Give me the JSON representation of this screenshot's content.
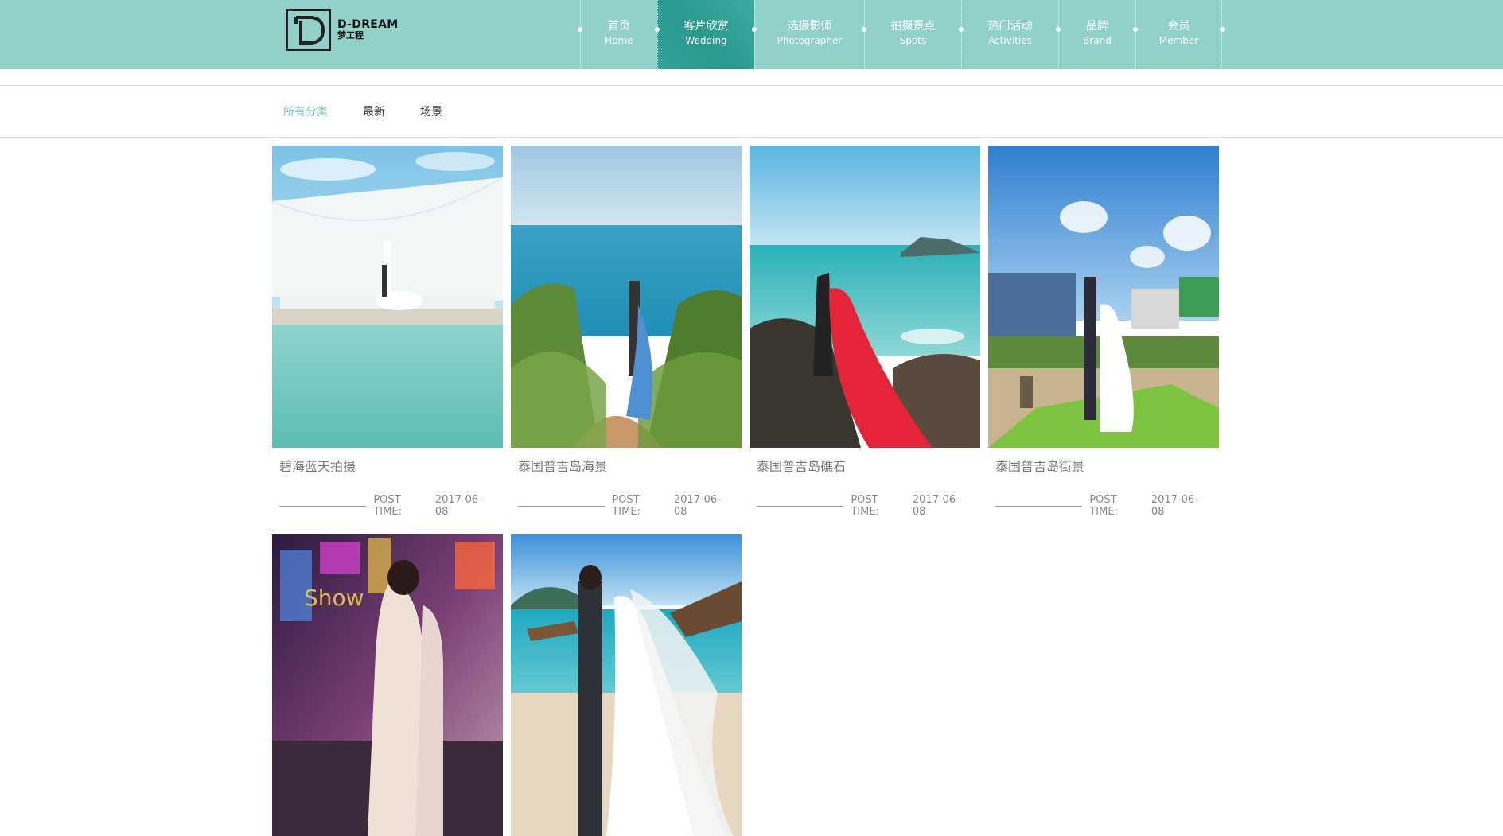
{
  "brand": {
    "title": "D-DREAM",
    "subtitle": "梦工程",
    "icon": "d-letter-logo-icon",
    "color": "#90d1ca",
    "accent": "#2a9a8e"
  },
  "nav": {
    "items": [
      {
        "cn": "首页",
        "en": "Home"
      },
      {
        "cn": "客片欣赏",
        "en": "Wedding"
      },
      {
        "cn": "选摄影师",
        "en": "Photographer"
      },
      {
        "cn": "拍摄景点",
        "en": "Spots"
      },
      {
        "cn": "热门活动",
        "en": "Activities"
      },
      {
        "cn": "品牌",
        "en": "Brand"
      },
      {
        "cn": "会员",
        "en": "Member"
      }
    ],
    "active": "Wedding"
  },
  "filters": {
    "items": [
      "所有分类",
      "最新",
      "场景"
    ],
    "active": "所有分类",
    "active_color": "#7cc7bf"
  },
  "gallery": {
    "post_label": "POST TIME:",
    "cards": [
      {
        "title": "碧海蓝天拍摄",
        "date": "2017-06-08",
        "photo": "couple-under-white-sail-canopy-reflecting-pool"
      },
      {
        "title": "泰国普吉岛海景",
        "date": "2017-06-08",
        "photo": "couple-on-grassy-cliff-above-turquoise-sea"
      },
      {
        "title": "泰国普吉岛礁石",
        "date": "2017-06-08",
        "photo": "couple-in-red-gown-on-rocks-by-sea"
      },
      {
        "title": "泰国普吉岛街景",
        "date": "2017-06-08",
        "photo": "couple-on-street-with-billboards"
      },
      {
        "title": "",
        "date": "",
        "photo": "couple-in-neon-lit-night-street"
      },
      {
        "title": "",
        "date": "",
        "photo": "couple-on-beach-with-longtail-boats"
      }
    ]
  }
}
